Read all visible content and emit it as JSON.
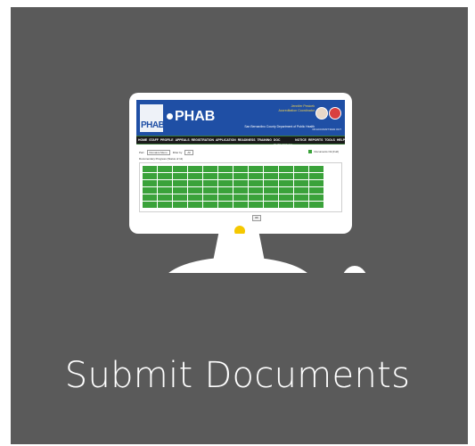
{
  "tile": {
    "title": "Submit Documents",
    "background": "#5a5a5a"
  },
  "screenshot": {
    "logo_text": "PHAB",
    "brand": "PHAB",
    "header_title": "Jennifer Pesicek",
    "header_subtitle": "Accreditation Coordinator",
    "department": "San Bernardino County Department of Public Health",
    "seal_caption": "ON ACCOUNT",
    "seal_caption_2": "SIGN OUT",
    "nav": [
      "HOME",
      "STAFF",
      "PROFILE",
      "APPEALS",
      "REGISTRATION",
      "APPLICATION",
      "READINESS",
      "TRAINING",
      "DOC SUBMISSION",
      "NOTICE",
      "REPORTS",
      "TOOLS",
      "HELP"
    ],
    "filter_label": "Part",
    "filter_value": "Domains Menu",
    "filter_label_2": "Filter by",
    "filter_value_2": "All",
    "legend_label": "Documents Ok (Full)",
    "grid_title": "Documentary Progress (Status of 11)",
    "ok_button": "OK",
    "colors": {
      "header": "#1f4fa5",
      "nav": "#1a1a1a",
      "cell_complete": "#3aa23a",
      "power_light": "#f5c800"
    }
  }
}
